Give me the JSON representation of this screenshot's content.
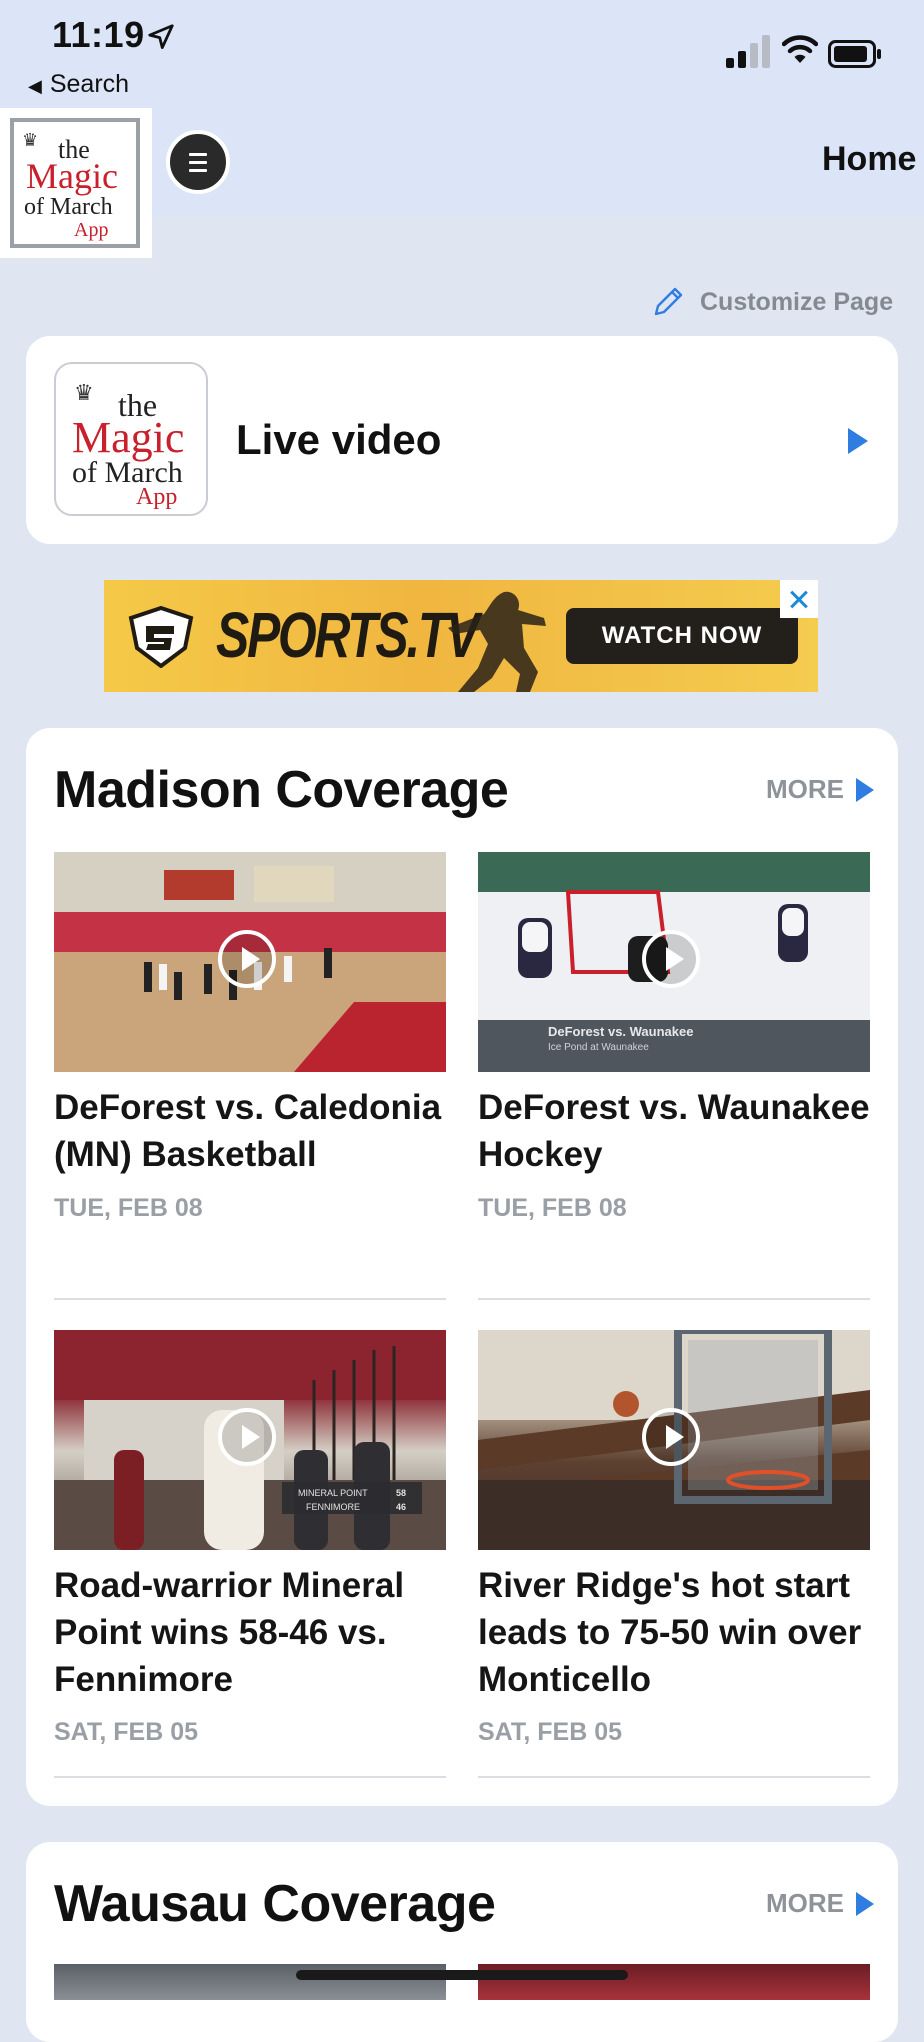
{
  "status_bar": {
    "time": "11:19",
    "back_label": "Search"
  },
  "header": {
    "logo_text": [
      "the",
      "Magic",
      "of March",
      "App"
    ],
    "title": "Home"
  },
  "customize": {
    "label": "Customize Page"
  },
  "live": {
    "label": "Live video"
  },
  "ad": {
    "brand": "SPORTS.TV",
    "cta": "WATCH NOW"
  },
  "sections": [
    {
      "title": "Madison Coverage",
      "more_label": "MORE",
      "items": [
        {
          "title": "DeForest vs. Caledonia (MN) Basketball",
          "date": "TUE, FEB 08"
        },
        {
          "title": "DeForest vs. Waunakee Hockey",
          "date": "TUE, FEB 08",
          "overlay": [
            "DeForest vs. Waunakee",
            "Ice Pond at Waunakee"
          ]
        },
        {
          "title": "Road-warrior Mineral Point wins 58-46 vs. Fennimore",
          "date": "SAT, FEB 05",
          "overlay": [
            "MINERAL POINT",
            "58",
            "FENNIMORE",
            "46"
          ]
        },
        {
          "title": "River Ridge's hot start leads to 75-50 win over Monticello",
          "date": "SAT, FEB 05"
        }
      ]
    },
    {
      "title": "Wausau Coverage",
      "more_label": "MORE"
    }
  ],
  "colors": {
    "accent": "#2f7de1",
    "background": "#dfe6f1",
    "header": "#dbe5f7"
  }
}
